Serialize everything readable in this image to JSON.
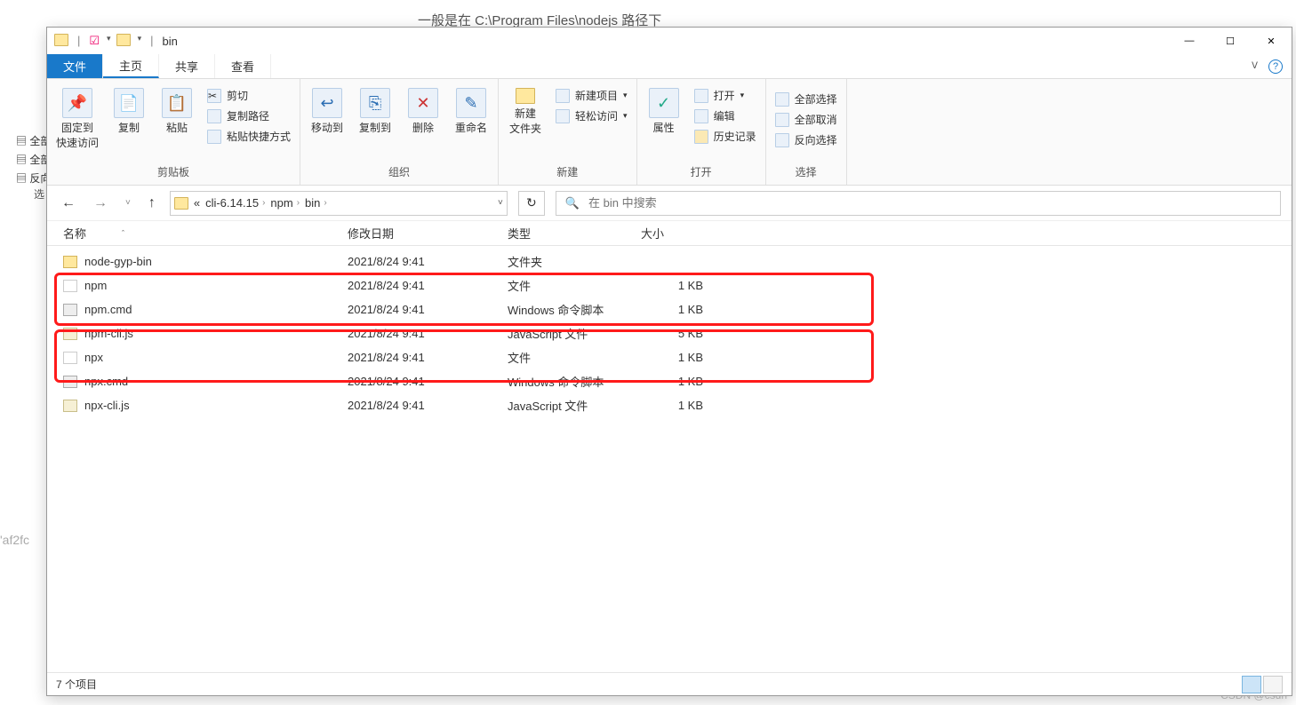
{
  "background": {
    "top_text": "一般是在 C:\\Program Files\\nodejs 路径下",
    "side": [
      "▤ 全部",
      "▤ 全部",
      "▤ 反向"
    ],
    "side_small": "选",
    "af": "'af2fc",
    "watermark": "CSDN @csdn"
  },
  "title": "bin",
  "tabs": {
    "file": "文件",
    "home": "主页",
    "share": "共享",
    "view": "查看"
  },
  "ribbon": {
    "clipboard": {
      "pin": "固定到\n快速访问",
      "copy": "复制",
      "paste": "粘贴",
      "cut": "剪切",
      "copypath": "复制路径",
      "shortcut": "粘贴快捷方式",
      "label": "剪贴板"
    },
    "organize": {
      "moveto": "移动到",
      "copyto": "复制到",
      "delete": "删除",
      "rename": "重命名",
      "label": "组织"
    },
    "new": {
      "folder": "新建\n文件夹",
      "newitem": "新建项目",
      "easyaccess": "轻松访问",
      "label": "新建"
    },
    "open": {
      "properties": "属性",
      "open": "打开",
      "edit": "编辑",
      "history": "历史记录",
      "label": "打开"
    },
    "select": {
      "all": "全部选择",
      "none": "全部取消",
      "invert": "反向选择",
      "label": "选择"
    }
  },
  "breadcrumb": {
    "prefix": "«",
    "parts": [
      "cli-6.14.15",
      "npm",
      "bin"
    ]
  },
  "search": {
    "placeholder": "在 bin 中搜索"
  },
  "columns": {
    "name": "名称",
    "date": "修改日期",
    "type": "类型",
    "size": "大小"
  },
  "files": [
    {
      "name": "node-gyp-bin",
      "date": "2021/8/24 9:41",
      "type": "文件夹",
      "size": "",
      "icon": "folder"
    },
    {
      "name": "npm",
      "date": "2021/8/24 9:41",
      "type": "文件",
      "size": "1 KB",
      "icon": "file"
    },
    {
      "name": "npm.cmd",
      "date": "2021/8/24 9:41",
      "type": "Windows 命令脚本",
      "size": "1 KB",
      "icon": "cmd"
    },
    {
      "name": "npm-cli.js",
      "date": "2021/8/24 9:41",
      "type": "JavaScript 文件",
      "size": "5 KB",
      "icon": "js"
    },
    {
      "name": "npx",
      "date": "2021/8/24 9:41",
      "type": "文件",
      "size": "1 KB",
      "icon": "file"
    },
    {
      "name": "npx.cmd",
      "date": "2021/8/24 9:41",
      "type": "Windows 命令脚本",
      "size": "1 KB",
      "icon": "cmd"
    },
    {
      "name": "npx-cli.js",
      "date": "2021/8/24 9:41",
      "type": "JavaScript 文件",
      "size": "1 KB",
      "icon": "js"
    }
  ],
  "status": "7 个项目"
}
